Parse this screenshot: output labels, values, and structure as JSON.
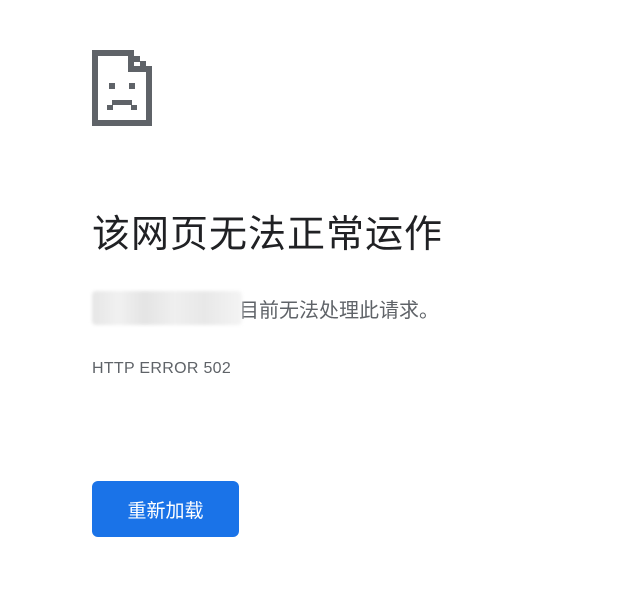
{
  "error_page": {
    "icon": "sad-page-icon",
    "title": "该网页无法正常运作",
    "description": "目前无法处理此请求。",
    "error_code": "HTTP ERROR 502",
    "reload_label": "重新加载"
  },
  "colors": {
    "title": "#202124",
    "secondary_text": "#5f6368",
    "button_bg": "#1a73e8",
    "button_text": "#ffffff",
    "icon": "#5f6368"
  }
}
